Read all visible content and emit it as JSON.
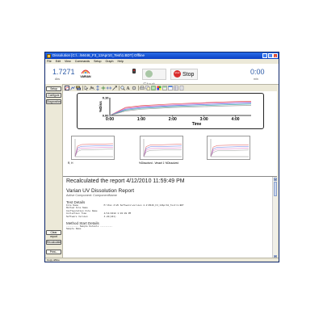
{
  "window": {
    "title": "Dissolution [C:\\...\\M446_F3_13Apr10_Test\\1.BDT] Offline",
    "minimize": "_",
    "maximize": "□",
    "close": "×"
  },
  "menu": [
    "File",
    "Edit",
    "View",
    "Commands",
    "Setup",
    "Graph",
    "Help"
  ],
  "status": {
    "reading": "1.7271",
    "reading_unit": "Abs",
    "brand": "VARIAN",
    "start_label": "Start",
    "stop_label": "Stop",
    "stop_icon_text": "STOP",
    "elapsed": "0:00",
    "elapsed_unit": "min"
  },
  "side_buttons": {
    "setup": "Setup",
    "configure": "Configure",
    "diagnostics": "Diagnostics",
    "clear_report": "Clear report",
    "recalculate": "Recalculate",
    "print": "Print..."
  },
  "chart_data": {
    "type": "line",
    "ylabel": "%Diss",
    "xlabel": "Time",
    "x_ticks": [
      "0:00",
      "1:00",
      "2:00",
      "3:00",
      "4:00"
    ],
    "y_ticks": [
      "0.10",
      "0.00"
    ],
    "xlim": [
      0,
      4.5
    ],
    "ylim": [
      0,
      0.1
    ],
    "series": [
      {
        "color": "#e05050",
        "x": [
          0,
          0.5,
          1,
          2,
          3,
          4,
          4.5
        ],
        "y": [
          0.0,
          0.045,
          0.055,
          0.065,
          0.072,
          0.078,
          0.08
        ]
      },
      {
        "color": "#e070c0",
        "x": [
          0,
          0.5,
          1,
          2,
          3,
          4,
          4.5
        ],
        "y": [
          0.0,
          0.04,
          0.05,
          0.06,
          0.068,
          0.074,
          0.076
        ]
      },
      {
        "color": "#6070e0",
        "x": [
          0,
          0.5,
          1,
          2,
          3,
          4,
          4.5
        ],
        "y": [
          0.0,
          0.035,
          0.045,
          0.055,
          0.062,
          0.068,
          0.07
        ]
      },
      {
        "color": "#50b0b0",
        "x": [
          0,
          0.5,
          1,
          2,
          3,
          4,
          4.5
        ],
        "y": [
          0.0,
          0.03,
          0.04,
          0.05,
          0.056,
          0.062,
          0.064
        ]
      },
      {
        "color": "#a0a0a0",
        "x": [
          0,
          0.5,
          1,
          2,
          3,
          4,
          4.5
        ],
        "y": [
          0.0,
          0.025,
          0.035,
          0.045,
          0.05,
          0.055,
          0.057
        ]
      }
    ]
  },
  "small_plots": {
    "colors": [
      "#e05050",
      "#6070e0",
      "#e070c0",
      "#999999"
    ]
  },
  "plot_footer": {
    "left": "R, H",
    "middle": "%Dissolved - Vessel 1 %Dissolved"
  },
  "report": {
    "header": "Recalculated the report  4/12/2010 11:59:49 PM",
    "title": "Varian UV Dissolution Report",
    "subtitle": "Active Component: ComponentName",
    "test_details": "Test Details",
    "rows": [
      {
        "k": "File Name",
        "v": "M:\\Pan 2\\UV Software\\version 4.2\\M446_F3_13Apr10_Test\\1.BDT"
      },
      {
        "k": "Method File Name",
        "v": ""
      },
      {
        "k": "Configuration File Name",
        "v": ""
      },
      {
        "k": "Collection Time",
        "v": "4/13/2010 1:03:09 PM"
      },
      {
        "k": "Software Version",
        "v": "4.20(441)"
      }
    ],
    "method_details": "Method Start Details",
    "sample_details": "--------- Sample Details ---------",
    "sample_name": "Sample Name"
  },
  "statusbar": "Copy offline"
}
